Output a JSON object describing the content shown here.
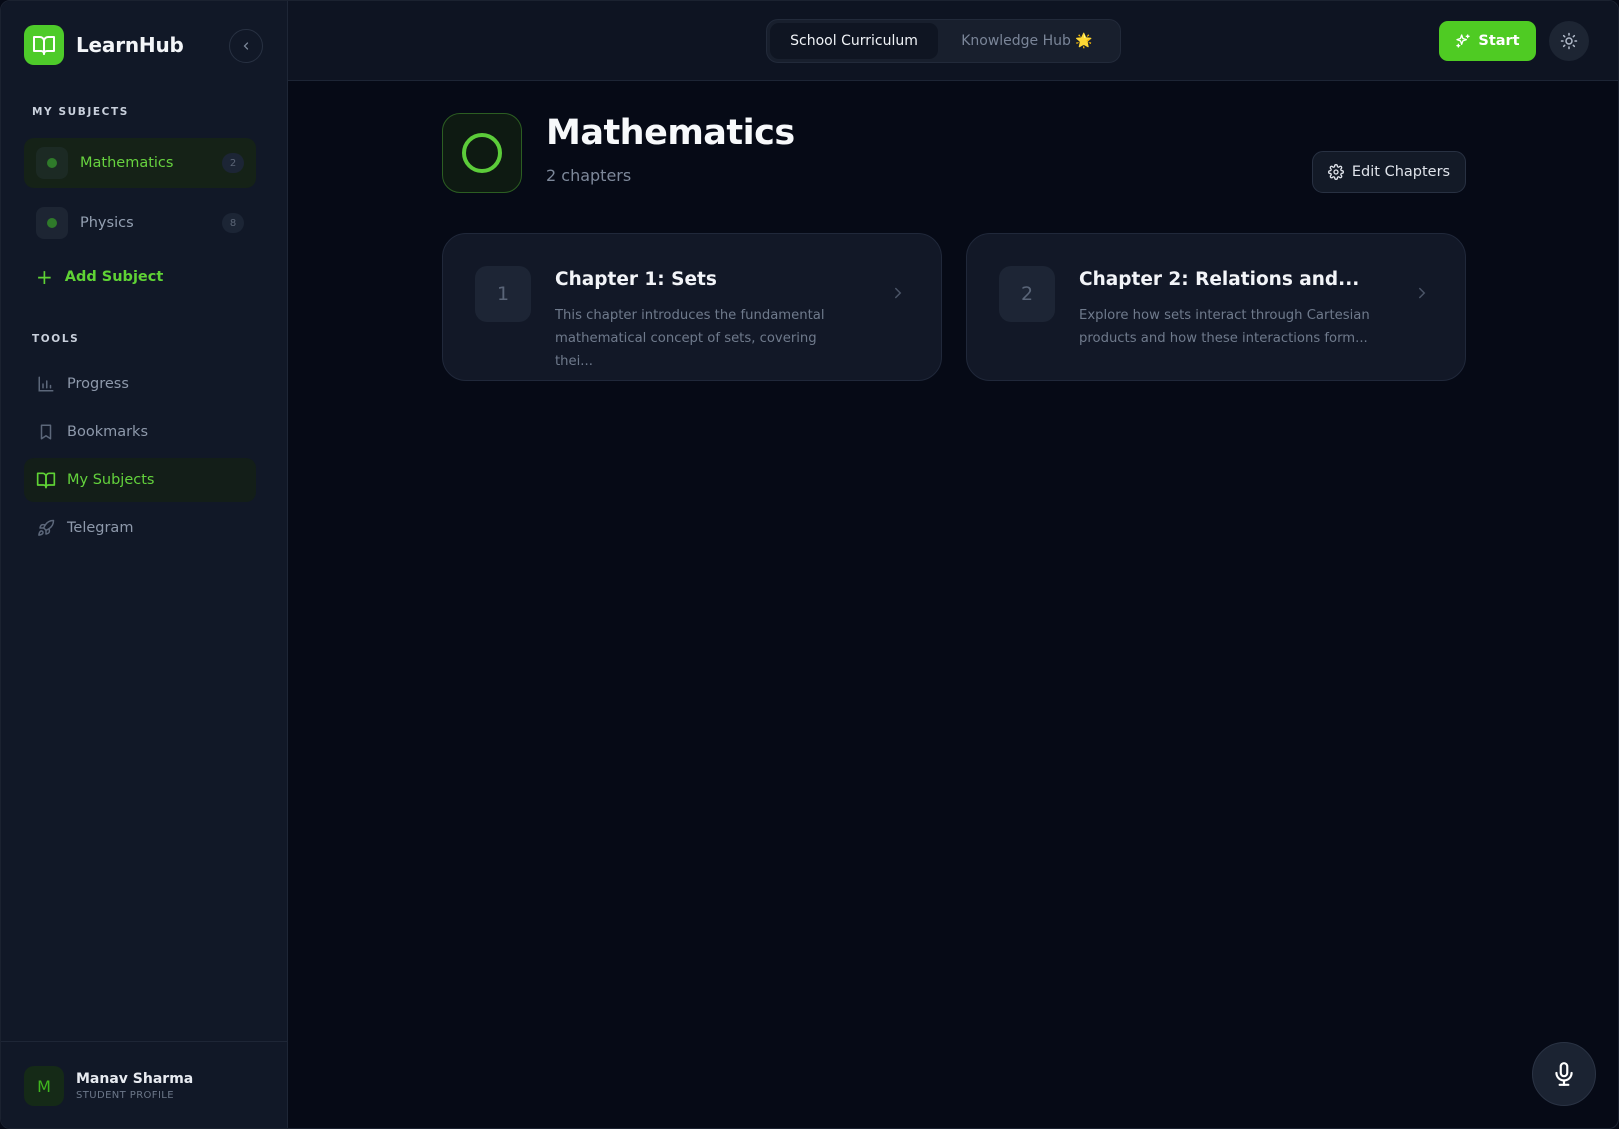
{
  "brand": {
    "name": "LearnHub",
    "logo_icon": "open-book-icon",
    "accent": "#4ecb2a"
  },
  "sidebar": {
    "subjects_heading": "MY SUBJECTS",
    "subjects": [
      {
        "name": "Mathematics",
        "count": "2",
        "active": true
      },
      {
        "name": "Physics",
        "count": "8",
        "active": false
      }
    ],
    "add_subject": "Add Subject",
    "tools_heading": "TOOLS",
    "tools": [
      {
        "label": "Progress",
        "icon": "bar-chart-icon",
        "active": false
      },
      {
        "label": "Bookmarks",
        "icon": "bookmark-icon",
        "active": false
      },
      {
        "label": "My Subjects",
        "icon": "open-book-icon",
        "active": true
      },
      {
        "label": "Telegram",
        "icon": "rocket-icon",
        "active": false
      }
    ]
  },
  "profile": {
    "initial": "M",
    "name": "Manav Sharma",
    "role": "STUDENT PROFILE"
  },
  "topbar": {
    "tabs": [
      {
        "label": "School Curriculum",
        "active": true
      },
      {
        "label": "Knowledge Hub 🌟",
        "active": false
      }
    ],
    "start_label": "Start"
  },
  "main": {
    "title": "Mathematics",
    "subtitle": "2 chapters",
    "edit_label": "Edit Chapters",
    "chapters": [
      {
        "number": "1",
        "title": "Chapter 1: Sets",
        "description": "This chapter introduces the fundamental mathematical concept of sets, covering thei..."
      },
      {
        "number": "2",
        "title": "Chapter 2: Relations and...",
        "description": "Explore how sets interact through Cartesian products and how these interactions form..."
      }
    ]
  }
}
